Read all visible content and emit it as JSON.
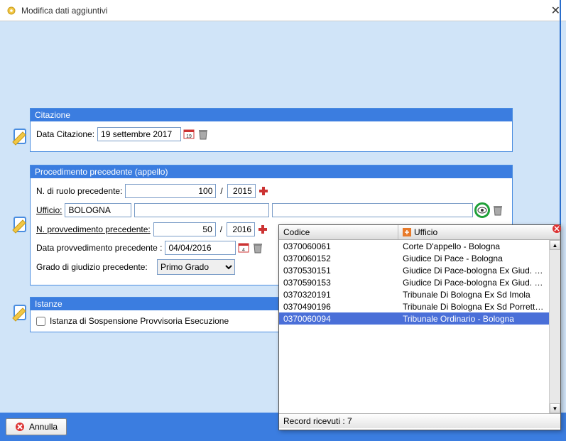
{
  "window": {
    "title": "Modifica dati aggiuntivi"
  },
  "citazione": {
    "header": "Citazione",
    "date_label": "Data Citazione:",
    "date_value": "19 settembre 2017"
  },
  "procedimento": {
    "header": "Procedimento precedente (appello)",
    "ruolo_label": "N. di ruolo precedente:",
    "ruolo_num": "100",
    "ruolo_year": "2015",
    "ufficio_label": "Ufficio:",
    "ufficio_value": "BOLOGNA",
    "ufficio_wide_value": "",
    "provv_label": "N. provvedimento precedente:",
    "provv_num": "50",
    "provv_year": "2016",
    "data_provv_label": "Data provvedimento precedente :",
    "data_provv_value": "04/04/2016",
    "grado_label": "Grado di giudizio precedente:",
    "grado_value": "Primo Grado"
  },
  "istanze": {
    "header": "Istanze",
    "sospensione_label": "Istanza di Sospensione Provvisoria Esecuzione"
  },
  "footer": {
    "annulla": "Annulla"
  },
  "dropdown": {
    "col1": "Codice",
    "col2": "Ufficio",
    "rows": [
      {
        "code": "0370060061",
        "name": "Corte D'appello - Bologna",
        "sel": false
      },
      {
        "code": "0370060152",
        "name": "Giudice Di Pace - Bologna",
        "sel": false
      },
      {
        "code": "0370530151",
        "name": "Giudice Di Pace-bologna Ex Giud. D...",
        "sel": false
      },
      {
        "code": "0370590153",
        "name": "Giudice Di Pace-bologna Ex Giud. D...",
        "sel": false
      },
      {
        "code": "0370320191",
        "name": "Tribunale Di Bologna Ex Sd Imola",
        "sel": false
      },
      {
        "code": "0370490196",
        "name": "Tribunale Di Bologna Ex Sd Porretta ...",
        "sel": false
      },
      {
        "code": "0370060094",
        "name": "Tribunale Ordinario - Bologna",
        "sel": true
      }
    ],
    "footer": "Record ricevuti : 7"
  }
}
